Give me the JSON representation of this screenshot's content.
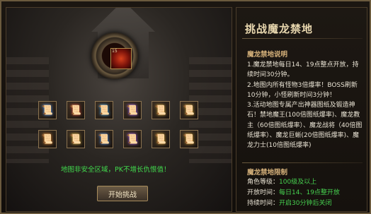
{
  "panel": {
    "title": "挑战魔龙禁地",
    "description_title": "魔龙禁地说明",
    "description": [
      "1.魔龙禁地每日14、19点整点开放，持续时间30分钟。",
      "2.地图内所有怪物3倍爆率！BOSS刷新10分钟，小怪刷新时间3分钟！",
      "3.活动地图专属产出神器图纸及锻造神石！禁地魔王(100倍图纸爆率)、魔龙教主（60倍图纸爆率）、魔龙战将（40倍图纸爆率）、魔龙巨蜥(20倍图纸爆率)、魔龙力士(10倍图纸爆率)"
    ],
    "limit_title": "魔龙禁地限制",
    "limits": [
      {
        "label": "角色等级：",
        "value": "100级及以上"
      },
      {
        "label": "开放时间：",
        "value": "每日14、19点整开放"
      },
      {
        "label": "持续时间：",
        "value": "开启30分钟后关闭"
      }
    ]
  },
  "scene": {
    "boss_level": "15",
    "warning": "地图非安全区域，PK不增长仇恨值！",
    "start_button": "开始挑战",
    "rewards": [
      {
        "icon": "blue-gem-scroll-icon",
        "glyph": "📜",
        "color": "#5aa0ff"
      },
      {
        "icon": "red-scroll-icon",
        "glyph": "📜",
        "color": "#e0503a"
      },
      {
        "icon": "blue-staff-scroll-icon",
        "glyph": "📜",
        "color": "#48b4ff"
      },
      {
        "icon": "purple-scroll-icon",
        "glyph": "📜",
        "color": "#b070ff"
      },
      {
        "icon": "gold-scroll-icon",
        "glyph": "📜",
        "color": "#e0b040"
      },
      {
        "icon": "gold-scroll-icon",
        "glyph": "📜",
        "color": "#d8a838"
      },
      {
        "icon": "orange-scroll-icon",
        "glyph": "📜",
        "color": "#e88a30"
      },
      {
        "icon": "gold-blade-scroll-icon",
        "glyph": "📜",
        "color": "#e0b840"
      },
      {
        "icon": "blue-scroll-icon",
        "glyph": "📜",
        "color": "#4a90f0"
      },
      {
        "icon": "purple-scroll-icon",
        "glyph": "📜",
        "color": "#a860f0"
      },
      {
        "icon": "gold-scroll-icon",
        "glyph": "📜",
        "color": "#e0a838"
      },
      {
        "icon": "gold-scroll-icon",
        "glyph": "📜",
        "color": "#d8a030"
      }
    ]
  }
}
